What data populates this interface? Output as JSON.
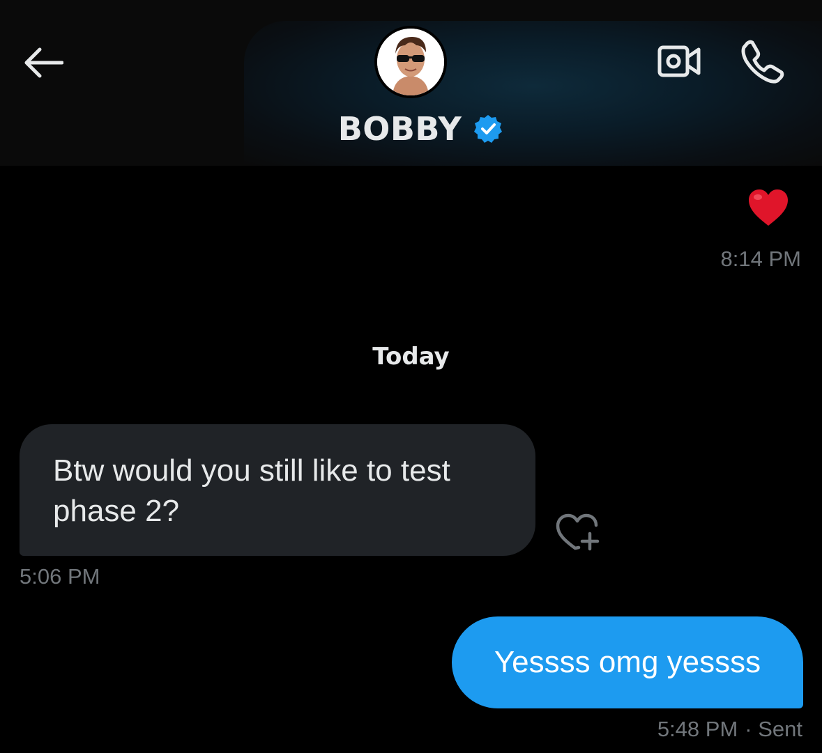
{
  "header": {
    "title": "BOBBY",
    "back_icon": "arrow-left-icon",
    "verified_icon": "verified-badge-icon",
    "video_icon": "video-camera-icon",
    "call_icon": "phone-icon",
    "verified_color": "#1d9bf0"
  },
  "messages": {
    "previous": {
      "reaction": "❤️",
      "time": "8:14 PM"
    },
    "day_divider": "Today",
    "incoming": {
      "text": "Btw would you still like to test phase 2?",
      "time": "5:06 PM",
      "react_icon": "heart-plus-icon"
    },
    "outgoing": {
      "text": "Yessss omg yessss",
      "time": "5:48 PM",
      "status": "· Sent"
    }
  },
  "colors": {
    "background": "#000000",
    "outgoing_bubble": "#1d9bf0",
    "incoming_bubble": "#202327",
    "muted_text": "#71767b"
  }
}
